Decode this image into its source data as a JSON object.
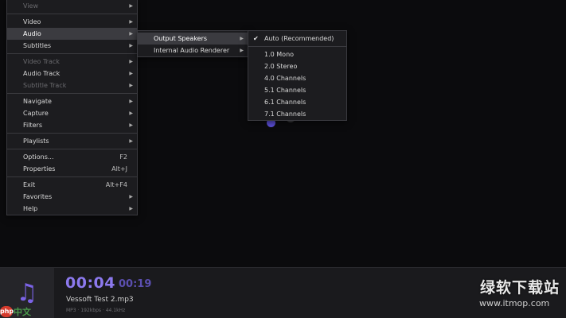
{
  "main_menu": {
    "items": [
      {
        "label": "View",
        "disabled": true,
        "submenu": true
      },
      {
        "label": "Video",
        "disabled": false,
        "submenu": true
      },
      {
        "label": "Audio",
        "disabled": false,
        "submenu": true,
        "active": true
      },
      {
        "label": "Subtitles",
        "disabled": false,
        "submenu": true
      },
      {
        "label": "Video Track",
        "disabled": true,
        "submenu": true
      },
      {
        "label": "Audio Track",
        "disabled": false,
        "submenu": true
      },
      {
        "label": "Subtitle Track",
        "disabled": true,
        "submenu": true
      },
      {
        "label": "Navigate",
        "disabled": false,
        "submenu": true
      },
      {
        "label": "Capture",
        "disabled": false,
        "submenu": true
      },
      {
        "label": "Filters",
        "disabled": false,
        "submenu": true
      },
      {
        "label": "Playlists",
        "disabled": false,
        "submenu": true
      },
      {
        "label": "Options...",
        "shortcut": "F2"
      },
      {
        "label": "Properties",
        "shortcut": "Alt+J"
      },
      {
        "label": "Exit",
        "shortcut": "Alt+F4"
      },
      {
        "label": "Favorites",
        "submenu": true
      },
      {
        "label": "Help",
        "submenu": true
      }
    ]
  },
  "audio_menu": {
    "items": [
      {
        "label": "Output Speakers",
        "submenu": true,
        "active": true
      },
      {
        "label": "Internal Audio Renderer",
        "submenu": true
      }
    ]
  },
  "speaker_menu": {
    "items": [
      {
        "label": "Auto (Recommended)",
        "checked": true
      },
      {
        "label": "1.0 Mono"
      },
      {
        "label": "2.0 Stereo"
      },
      {
        "label": "4.0 Channels"
      },
      {
        "label": "5.1 Channels"
      },
      {
        "label": "6.1 Channels"
      },
      {
        "label": "7.1 Channels"
      }
    ]
  },
  "player": {
    "current_time": "00:04",
    "total_time": "00:19",
    "track_title": "Vessoft Test 2.mp3",
    "track_info": "MP3 · 192kbps · 44.1kHz",
    "album_icon": "music-note-icon"
  },
  "watermark": {
    "logo_text": "php",
    "logo_cn": "中文网",
    "site_cn": "绿软下载站",
    "site_url": "www.itmop.com"
  },
  "icons": {
    "submenu_arrow": "▶",
    "check": "✔"
  },
  "colors": {
    "accent": "#8c79ee",
    "accent_dim": "#5b4fb0",
    "menu_bg": "#1c1c1f",
    "menu_active": "#3b3b40"
  }
}
